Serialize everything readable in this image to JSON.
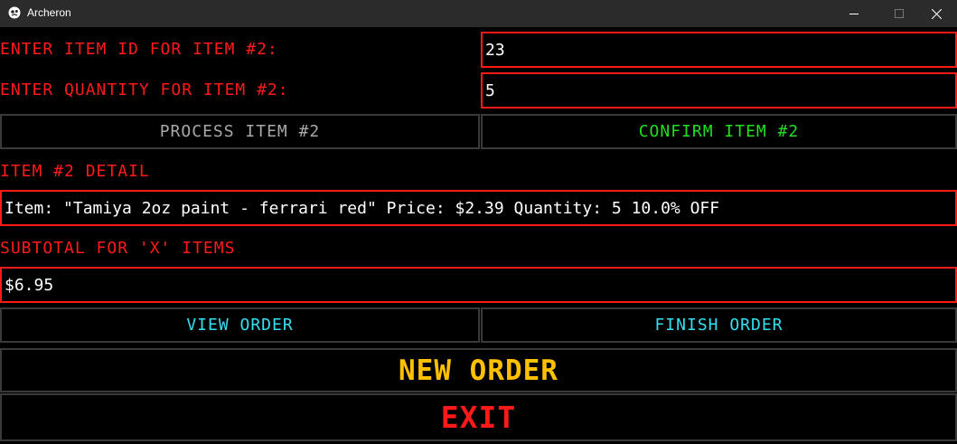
{
  "window": {
    "title": "Archeron"
  },
  "form": {
    "item_id_label": "ENTER ITEM ID FOR ITEM #2:",
    "item_id_value": "23",
    "quantity_label": "ENTER QUANTITY FOR ITEM #2:",
    "quantity_value": "5"
  },
  "actions": {
    "process_label": "PROCESS ITEM #2",
    "confirm_label": "CONFIRM ITEM #2",
    "view_order_label": "VIEW ORDER",
    "finish_order_label": "FINISH ORDER",
    "new_order_label": "NEW ORDER",
    "exit_label": "EXIT"
  },
  "detail": {
    "heading": "ITEM #2 DETAIL",
    "text": "Item: \"Tamiya 2oz paint - ferrari red\"  Price: $2.39  Quantity: 5  10.0% OFF"
  },
  "subtotal": {
    "heading": "SUBTOTAL FOR 'X' ITEMS",
    "value": "$6.95"
  },
  "colors": {
    "label_red": "#ff1a1a",
    "process_gray": "#a8a8a8",
    "confirm_green": "#22dd22",
    "cyan": "#33e0f0",
    "new_order_yellow": "#ffc000",
    "exit_red": "#ff1a1a"
  },
  "icons": {
    "app": "app-icon",
    "minimize": "minimize-icon",
    "maximize": "maximize-icon",
    "close": "close-icon"
  }
}
